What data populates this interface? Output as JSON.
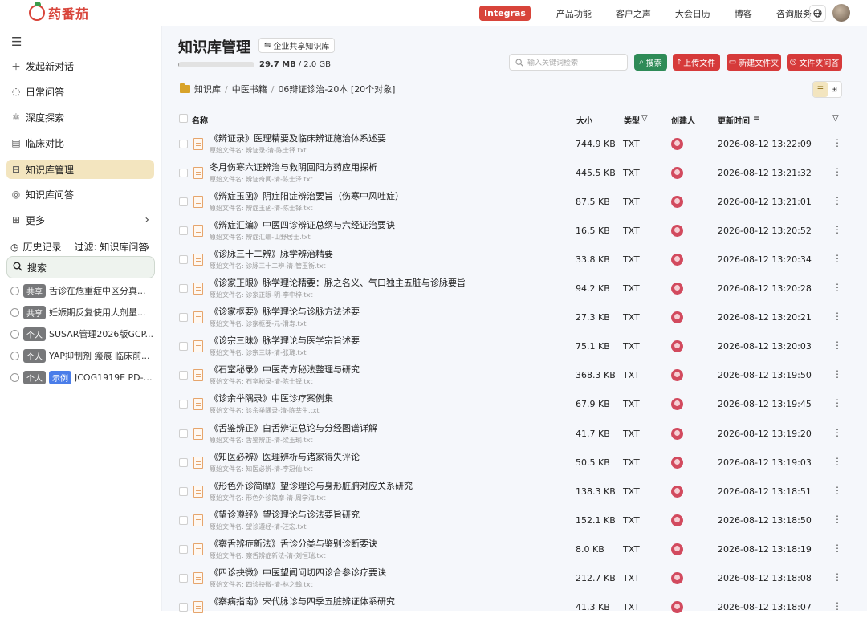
{
  "brand": {
    "name": "药番茄",
    "logo_color": "#d8443a"
  },
  "topnav": {
    "badge": "Integras",
    "items": [
      "产品功能",
      "客户之声",
      "大会日历",
      "博客",
      "咨询服务"
    ],
    "globe_icon": "globe-icon"
  },
  "sidebar": {
    "items": [
      {
        "label": "发起新对话",
        "icon": "plus-icon"
      },
      {
        "label": "日常问答",
        "icon": "chat-bubble-icon"
      },
      {
        "label": "深度探索",
        "icon": "atom-icon"
      },
      {
        "label": "临床对比",
        "icon": "compare-icon"
      },
      {
        "label": "知识库管理",
        "icon": "knowledge-base-icon",
        "active": true
      },
      {
        "label": "知识库问答",
        "icon": "target-icon"
      },
      {
        "label": "更多",
        "icon": "grid-icon"
      }
    ],
    "history_label": "历史记录",
    "history_filter": "过滤: 知识库问答",
    "search_label": "搜索",
    "chats": [
      {
        "tags": [
          "共享"
        ],
        "title": "舌诊在危重症中区分真..."
      },
      {
        "tags": [
          "共享"
        ],
        "title": "妊娠期反复使用大剂量..."
      },
      {
        "tags": [
          "个人"
        ],
        "title": "SUSAR管理2026版GCP..."
      },
      {
        "tags": [
          "个人"
        ],
        "title": "YAP抑制剂 瘢痕 临床前..."
      },
      {
        "tags": [
          "个人",
          "示例"
        ],
        "title": "JCOG1919E PD-L..."
      }
    ]
  },
  "main": {
    "title": "知识库管理",
    "share_button": "企业共享知识库",
    "storage": {
      "used": "29.7 MB",
      "total": "/ 2.0 GB",
      "fraction": 0.015
    },
    "search_placeholder": "输入关键词检索",
    "buttons": {
      "search": "搜索",
      "upload": "上传文件",
      "new_folder": "新建文件夹",
      "folder_qa": "文件夹问答"
    },
    "breadcrumb": [
      "知识库",
      "中医书籍",
      "06辩证诊治-20本 [20个对象]"
    ],
    "columns": {
      "name": "名称",
      "size": "大小",
      "type": "类型",
      "creator": "创建人",
      "updated": "更新时间"
    },
    "files": [
      {
        "title": "《辨证录》医理精要及临床辨证施治体系述要",
        "original": "原始文件名: 辨证录-清-陈士铎.txt",
        "size": "744.9 KB",
        "type": "TXT",
        "time": "2026-08-12 13:22:09"
      },
      {
        "title": "冬月伤寒六证辨治与救阴回阳方药应用探析",
        "original": "原始文件名: 辨证奇闻-清-陈士泽.txt",
        "size": "445.5 KB",
        "type": "TXT",
        "time": "2026-08-12 13:21:32"
      },
      {
        "title": "《辨症玉函》阴症阳症辨治要旨（伤寒中风吐症）",
        "original": "原始文件名: 辨症玉函-清-陈士铎.txt",
        "size": "87.5 KB",
        "type": "TXT",
        "time": "2026-08-12 13:21:01"
      },
      {
        "title": "《辨症汇编》中医四诊辨证总纲与六经证治要诀",
        "original": "原始文件名: 辨症汇编-山野居士.txt",
        "size": "16.5 KB",
        "type": "TXT",
        "time": "2026-08-12 13:20:52"
      },
      {
        "title": "《诊脉三十二辨》脉学辨治精要",
        "original": "原始文件名: 诊脉三十二辨-清-管玉衡.txt",
        "size": "33.8 KB",
        "type": "TXT",
        "time": "2026-08-12 13:20:34"
      },
      {
        "title": "《诊家正眼》脉学理论精要：脉之名义、气口独主五脏与诊脉要旨",
        "original": "原始文件名: 诊家正眼-明-李中梓.txt",
        "size": "94.2 KB",
        "type": "TXT",
        "time": "2026-08-12 13:20:28"
      },
      {
        "title": "《诊家枢要》脉学理论与诊脉方法述要",
        "original": "原始文件名: 诊家枢要-元-滑寿.txt",
        "size": "27.3 KB",
        "type": "TXT",
        "time": "2026-08-12 13:20:21"
      },
      {
        "title": "《诊宗三昧》脉学理论与医学宗旨述要",
        "original": "原始文件名: 诊宗三昧-清-张璐.txt",
        "size": "75.1 KB",
        "type": "TXT",
        "time": "2026-08-12 13:20:03"
      },
      {
        "title": "《石室秘录》中医奇方秘法整理与研究",
        "original": "原始文件名: 石室秘录-清-陈士铎.txt",
        "size": "368.3 KB",
        "type": "TXT",
        "time": "2026-08-12 13:19:50"
      },
      {
        "title": "《诊余举隅录》中医诊疗案例集",
        "original": "原始文件名: 诊余举隅录-清-陈莘生.txt",
        "size": "67.9 KB",
        "type": "TXT",
        "time": "2026-08-12 13:19:45"
      },
      {
        "title": "《舌鉴辨正》白舌辨证总论与分经图谱详解",
        "original": "原始文件名: 舌鉴辨正-清-梁玉瑜.txt",
        "size": "41.7 KB",
        "type": "TXT",
        "time": "2026-08-12 13:19:20"
      },
      {
        "title": "《知医必辨》医理辨析与诸家得失评论",
        "original": "原始文件名: 知医必辨-清-李冠仙.txt",
        "size": "50.5 KB",
        "type": "TXT",
        "time": "2026-08-12 13:19:03"
      },
      {
        "title": "《形色外诊简摩》望诊理论与身形脏腑对应关系研究",
        "original": "原始文件名: 形色外诊简摩-清-周学海.txt",
        "size": "138.3 KB",
        "type": "TXT",
        "time": "2026-08-12 13:18:51"
      },
      {
        "title": "《望诊遵经》望诊理论与诊法要旨研究",
        "original": "原始文件名: 望诊遵经-清-汪宏.txt",
        "size": "152.1 KB",
        "type": "TXT",
        "time": "2026-08-12 13:18:50"
      },
      {
        "title": "《察舌辨症新法》舌诊分类与鉴别诊断要诀",
        "original": "原始文件名: 察舌辨症新法-清-刘恒瑞.txt",
        "size": "8.0 KB",
        "type": "TXT",
        "time": "2026-08-12 13:18:19"
      },
      {
        "title": "《四诊抉微》中医望闻问切四诊合参诊疗要诀",
        "original": "原始文件名: 四诊抉微-清-林之翰.txt",
        "size": "212.7 KB",
        "type": "TXT",
        "time": "2026-08-12 13:18:08"
      },
      {
        "title": "《察病指南》宋代脉诊与四季五脏辨证体系研究",
        "original": "",
        "size": "41.3 KB",
        "type": "TXT",
        "time": "2026-08-12 13:18:07"
      }
    ]
  }
}
